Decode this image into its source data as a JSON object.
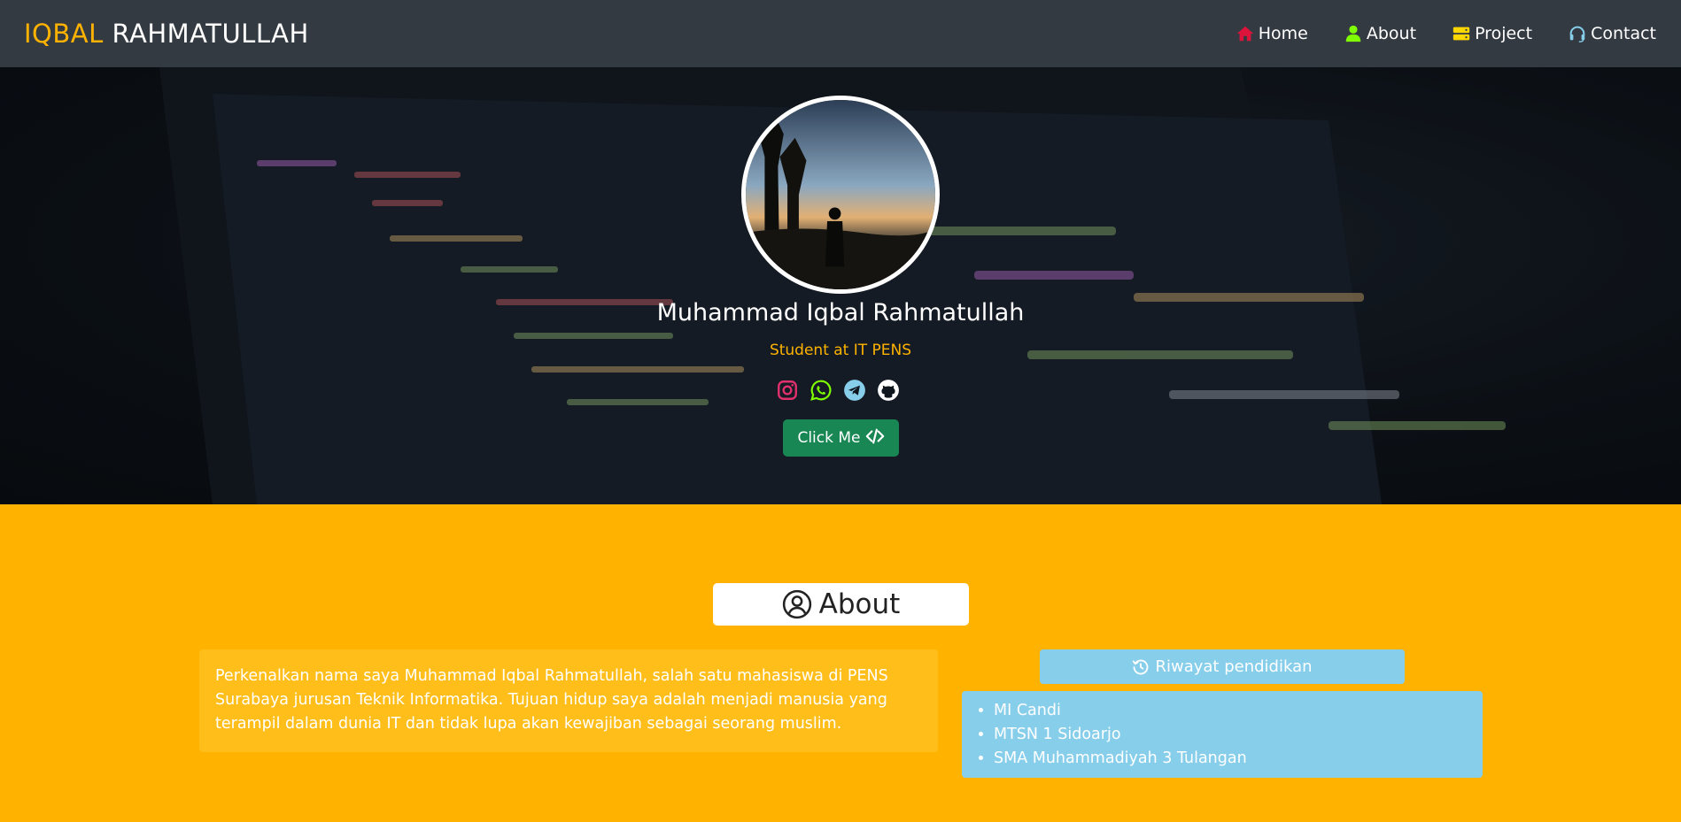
{
  "brand": {
    "first": "IQBAL",
    "last": "RAHMATULLAH"
  },
  "nav": [
    {
      "label": "Home",
      "icon": "home-icon",
      "color": "#dc143c"
    },
    {
      "label": "About",
      "icon": "user-icon",
      "color": "#7fff00"
    },
    {
      "label": "Project",
      "icon": "server-icon",
      "color": "#ffd700"
    },
    {
      "label": "Contact",
      "icon": "headset-icon",
      "color": "#87ceeb"
    }
  ],
  "hero": {
    "name": "Muhammad Iqbal Rahmatullah",
    "role": "Student at IT PENS",
    "socials": [
      {
        "icon": "instagram-icon",
        "color": "#e1306c"
      },
      {
        "icon": "whatsapp-icon",
        "color": "#7fff00"
      },
      {
        "icon": "telegram-icon",
        "color": "#87ceeb"
      },
      {
        "icon": "github-icon",
        "color": "#ffffff"
      }
    ],
    "cta_label": "Click Me"
  },
  "about": {
    "title": "About",
    "intro": "Perkenalkan nama saya Muhammad Iqbal Rahmatullah, salah satu mahasiswa di PENS Surabaya jurusan Teknik Informatika. Tujuan hidup saya adalah menjadi manusia yang terampil dalam dunia IT dan tidak lupa akan kewajiban sebagai seorang muslim.",
    "education_title": "Riwayat pendidikan",
    "education": [
      "MI Candi",
      "MTSN 1 Sidoarjo",
      "SMA Muhammadiyah 3 Tulangan"
    ]
  },
  "colors": {
    "accent": "#ffb300",
    "navbar": "#343a42",
    "button": "#198754",
    "edu": "#87ceeb"
  }
}
